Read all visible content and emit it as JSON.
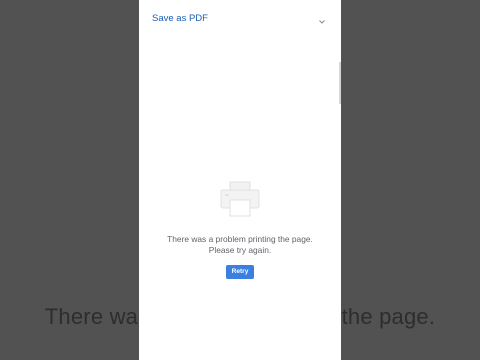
{
  "background": {
    "caption": "There was a problem printing the page."
  },
  "print_preview": {
    "destination_label": "Save as PDF",
    "destination_icon": "chevron-down-icon",
    "empty_state_icon": "printer-icon",
    "error_line_1": "There was a problem printing the page.",
    "error_line_2": "Please try again.",
    "retry_label": "Retry"
  },
  "colors": {
    "accent": "#3b7fe0",
    "link_text": "#1a5fb4",
    "dim_background": "#525252"
  }
}
